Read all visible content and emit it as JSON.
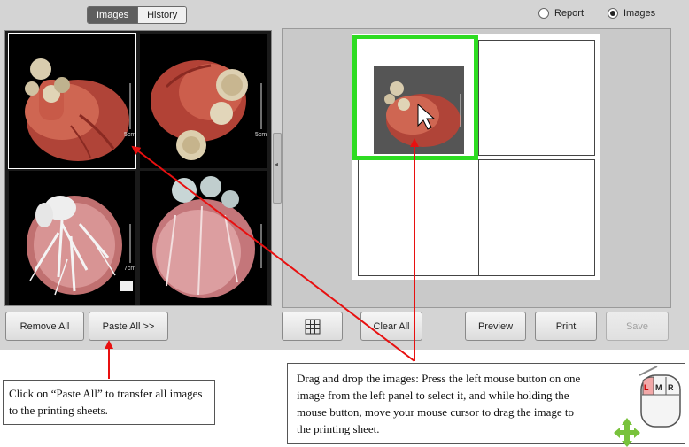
{
  "tabs": [
    {
      "label": "Images",
      "active": true
    },
    {
      "label": "History",
      "active": false
    }
  ],
  "output_mode": {
    "options": [
      {
        "label": "Report",
        "selected": false
      },
      {
        "label": "Images",
        "selected": true
      }
    ]
  },
  "thumbnails": [
    {
      "name": "heart-anterior-view",
      "scale_label": "5cm",
      "selected": true
    },
    {
      "name": "heart-superior-view",
      "scale_label": "5cm",
      "selected": false
    },
    {
      "name": "coronary-tree-view",
      "scale_label": "7cm",
      "selected": false
    },
    {
      "name": "heart-posterior-view",
      "scale_label": "",
      "selected": false
    }
  ],
  "left_buttons": {
    "remove_all": "Remove All",
    "paste_all": "Paste All >>"
  },
  "right_buttons": {
    "layout_icon": "grid-icon",
    "clear_all": "Clear All",
    "preview": "Preview",
    "print": "Print",
    "save": "Save"
  },
  "colors": {
    "highlight": "#2edc22",
    "arrow": "#e81010",
    "move_icon": "#78c23c"
  },
  "callouts": {
    "paste": "Click on “Paste All” to transfer all images to the printing sheets.",
    "drag": "Drag and drop the images: Press the left mouse button on one image from the left panel to select it, and while holding the mouse button, move your mouse cursor to drag the image to the printing sheet."
  },
  "mouse_icon": {
    "buttons": [
      "L",
      "M",
      "R"
    ]
  }
}
